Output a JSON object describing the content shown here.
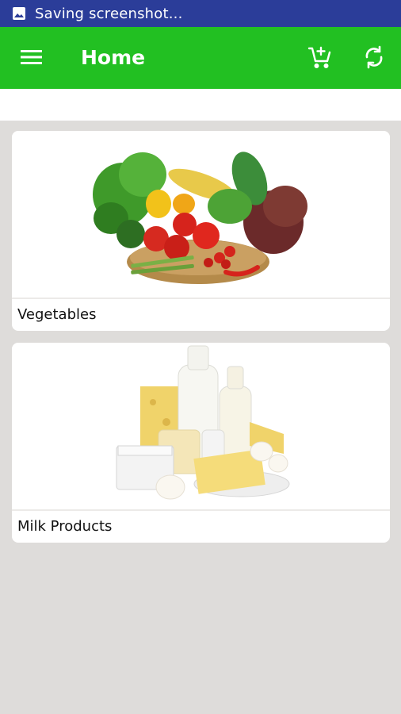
{
  "status_bar": {
    "text": "Saving screenshot...",
    "icon": "image-icon",
    "background": "#2b3d99"
  },
  "app_bar": {
    "title": "Home",
    "background": "#22c022",
    "icons": [
      "menu-icon",
      "add-to-cart-icon",
      "refresh-icon"
    ]
  },
  "categories": [
    {
      "label": "Vegetables",
      "image": "vegetables-basket-image"
    },
    {
      "label": "Milk Products",
      "image": "dairy-products-image"
    }
  ]
}
